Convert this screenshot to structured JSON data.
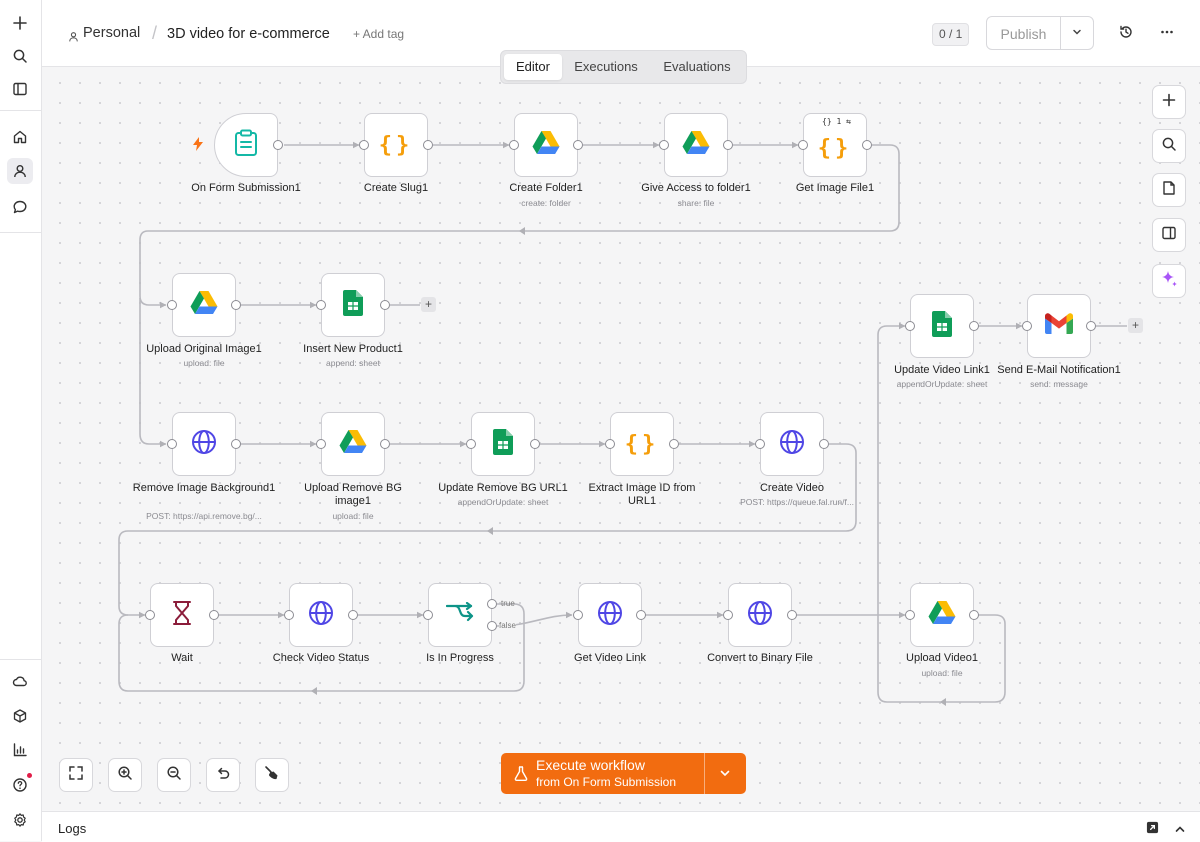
{
  "header": {
    "project": "Personal",
    "workflow_name": "3D video for e-commerce",
    "add_tag": "+ Add tag",
    "version_counter": "0 / 1",
    "publish_label": "Publish"
  },
  "tabs": [
    "Editor",
    "Executions",
    "Evaluations"
  ],
  "nodes": [
    {
      "label": "On Form Submission1",
      "sub": ""
    },
    {
      "label": "Create Slug1",
      "sub": ""
    },
    {
      "label": "Create Folder1",
      "sub": "create: folder"
    },
    {
      "label": "Give Access to folder1",
      "sub": "share: file"
    },
    {
      "label": "Get Image File1",
      "sub": ""
    },
    {
      "label": "Upload Original Image1",
      "sub": "upload: file"
    },
    {
      "label": "Insert New Product1",
      "sub": "append: sheet"
    },
    {
      "label": "Update Video Link1",
      "sub": "appendOrUpdate: sheet"
    },
    {
      "label": "Send E-Mail Notification1",
      "sub": "send: message"
    },
    {
      "label": "Remove Image Background1",
      "sub": "POST: https://api.remove.bg/..."
    },
    {
      "label": "Upload Remove BG image1",
      "sub": "upload: file"
    },
    {
      "label": "Update Remove BG URL1",
      "sub": "appendOrUpdate: sheet"
    },
    {
      "label": "Extract Image ID from URL1",
      "sub": ""
    },
    {
      "label": "Create Video",
      "sub": "POST: https://queue.fal.run/f..."
    },
    {
      "label": "Wait",
      "sub": ""
    },
    {
      "label": "Check Video Status",
      "sub": ""
    },
    {
      "label": "Is In Progress",
      "sub": ""
    },
    {
      "label": "Get Video Link",
      "sub": ""
    },
    {
      "label": "Convert to Binary File",
      "sub": ""
    },
    {
      "label": "Upload Video1",
      "sub": "upload: file"
    }
  ],
  "branch_labels": {
    "true": "true",
    "false": "false"
  },
  "execute": {
    "title": "Execute workflow",
    "subtitle": "from On Form Submission"
  },
  "logs": {
    "label": "Logs"
  },
  "get_image_badge": "{} 1 ⇆",
  "colors": {
    "accent": "#f26c10",
    "trigger_bolt": "#f97316",
    "ai_sparkle": "#a855f7"
  },
  "icons": {
    "left_rail": [
      "plus-icon",
      "search-icon",
      "sidebar-icon",
      "home-icon",
      "user-icon",
      "chat-icon",
      "cloud-icon",
      "templates-icon",
      "insights-icon",
      "help-icon",
      "settings-icon"
    ],
    "right_rail": [
      "plus-icon",
      "search-icon",
      "sticky-note-icon",
      "panel-icon",
      "ai-sparkle-icon"
    ]
  }
}
